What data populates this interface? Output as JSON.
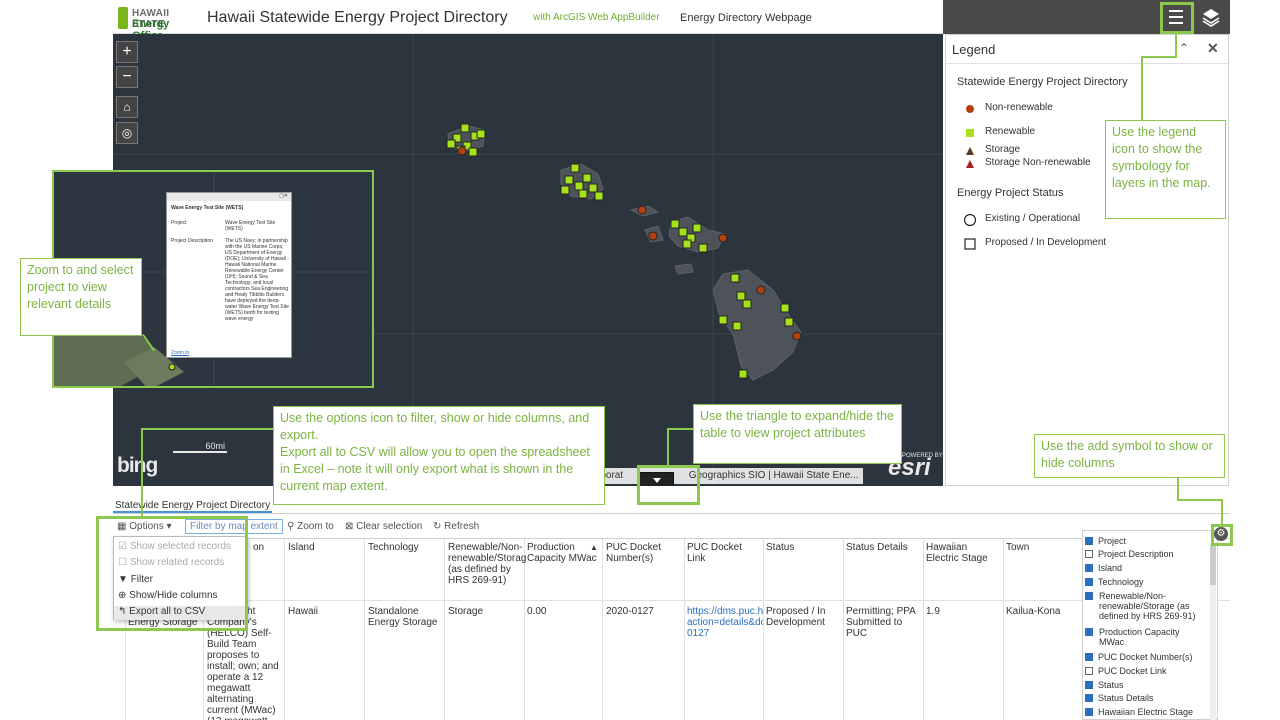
{
  "header": {
    "logo_line1": "HAWAII STATE",
    "logo_line2": "Energy Office",
    "title": "Hawaii Statewide Energy Project Directory",
    "subtitle": "with ArcGIS Web AppBuilder",
    "link": "Energy Directory Webpage",
    "icons": [
      "list-icon",
      "layers-icon"
    ]
  },
  "map": {
    "zoom_in": "+",
    "zoom_out": "−",
    "bing_logo": "bing",
    "esri_logo": "esri",
    "powered_by": "POWERED BY",
    "scale_label": "60mi",
    "attribution_prefix": "rporat",
    "attribution": "Geographics SIO | Hawaii State Ene..."
  },
  "legend": {
    "title": "Legend",
    "section1": "Statewide Energy Project Directory",
    "items1": [
      "Non-renewable",
      "Renewable",
      "Storage",
      "Storage Non-renewable"
    ],
    "section2": "Energy Project Status",
    "items2": [
      "Existing / Operational",
      "Proposed / In Development"
    ],
    "colors": {
      "nonrenewable": "#b5400f",
      "renewable": "#a6e21a",
      "storage": "#5a3a1a",
      "storage_nonrenewable": "#a81e1e"
    }
  },
  "table": {
    "tab": "Statewide Energy Project Directory",
    "toolbar": {
      "options": "Options",
      "filter_by_extent": "Filter by map extent",
      "zoom_to": "Zoom to",
      "clear_selection": "Clear selection",
      "refresh": "Refresh"
    },
    "options_menu": [
      "Show selected records",
      "Show related records",
      "Filter",
      "Show/Hide columns",
      "Export all to CSV"
    ],
    "columns": {
      "project_partial": "on",
      "island": "Island",
      "technology": "Technology",
      "renewable": "Renewable/Non-renewable/Storag (as defined by HRS 269-91)",
      "capacity": "Production Capacity MWac",
      "docket": "PUC Docket Number(s)",
      "docket_link": "PUC Docket Link",
      "status": "Status",
      "status_details": "Status Details",
      "he_stage": "Hawaiian Electric Stage",
      "town": "Town"
    },
    "row": {
      "project_partial": "Energy Storage",
      "description": "ectric Light Company's (HELCO) Self-Build Team proposes to install; own; and operate a 12 megawatt alternating current (MWac) (12 megawatt",
      "island": "Hawaii",
      "technology": "Standalone Energy Storage",
      "renewable": "Storage",
      "capacity": "0.00",
      "docket": "2020-0127",
      "docket_link": "https://dms.puc.h action=details&do 0127",
      "status": "Proposed / In Development",
      "status_details": "Permitting; PPA Submitted to PUC",
      "he_stage": "1.9",
      "town": "Kailua-Kona"
    },
    "column_chooser": [
      {
        "label": "Project",
        "checked": true
      },
      {
        "label": "Project Description",
        "checked": false
      },
      {
        "label": "Island",
        "checked": true
      },
      {
        "label": "Technology",
        "checked": true
      },
      {
        "label": "Renewable/Non-renewable/Storage (as defined by HRS 269-91)",
        "checked": true
      },
      {
        "label": "Production Capacity MWac",
        "checked": true
      },
      {
        "label": "PUC Docket Number(s)",
        "checked": true
      },
      {
        "label": "PUC Docket Link",
        "checked": false
      },
      {
        "label": "Status",
        "checked": true
      },
      {
        "label": "Status Details",
        "checked": true
      },
      {
        "label": "Hawaiian Electric Stage",
        "checked": true
      }
    ]
  },
  "popup": {
    "title": "Wave Energy Test Site (WETS)",
    "project_key": "Project",
    "project_val": "Wave Energy Test Site (WETS)",
    "desc_key": "Project Description",
    "desc_val": "The US Navy; in partnership with the US Marine Corps; US Department of Energy (DOE); University of Hawaii - Hawaii National Marine Renewable Energy Center (UH); Sound & Sea Technology; and local contractors Sea Engineering and Healy Tibbitts Builders have deployed the deep-water Wave Energy Test Site (WETS) berth for testing wave energy",
    "zoom_link": "Zoom to"
  },
  "callouts": {
    "legend": "Use the legend icon to show the symbology for layers in the map.",
    "zoom": "Zoom to and select project to view relevant details",
    "options": "Use the options icon to filter, show or hide columns, and export.\nExport all to CSV will allow you to open the spreadsheet in Excel – note it will only export what is shown in the current map extent.",
    "triangle": "Use the triangle to expand/hide the table to view project attributes",
    "add": "Use the add symbol to show or hide columns"
  }
}
